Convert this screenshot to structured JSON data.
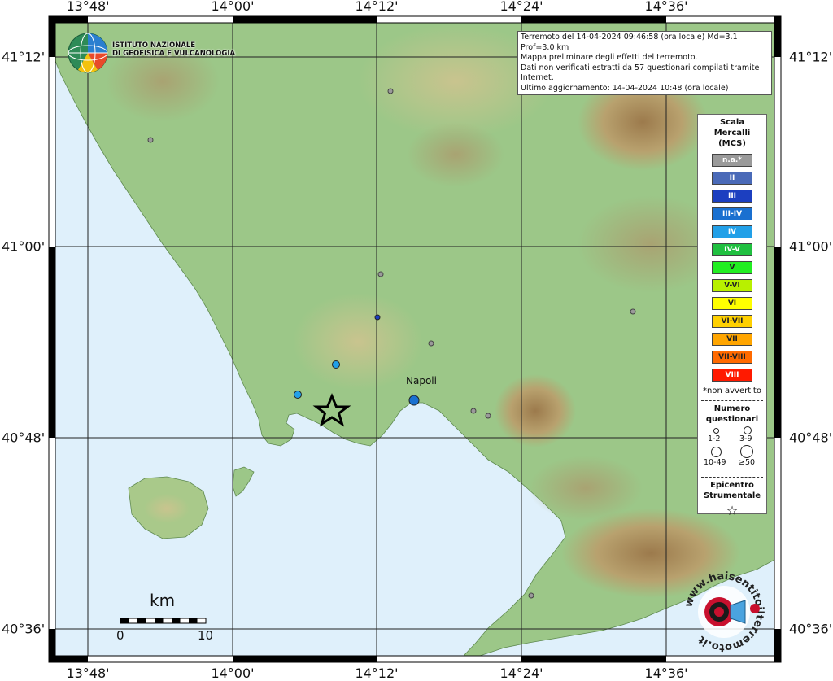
{
  "map": {
    "lon_labels": [
      "13°48'",
      "14°00'",
      "14°12'",
      "14°24'",
      "14°36'"
    ],
    "lat_labels": [
      "41°12'",
      "41°00'",
      "40°48'",
      "40°36'"
    ],
    "city_label": "Napoli"
  },
  "header": {
    "org_line1": "ISTITUTO NAZIONALE",
    "org_line2": "DI GEOFISICA E VULCANOLOGIA"
  },
  "info": {
    "line1": "Terremoto del 14-04-2024 09:46:58 (ora locale) Md=3.1 Prof=3.0 km",
    "line2": "Mappa preliminare degli effetti del terremoto.",
    "line3": "Dati non verificati estratti da 57 questionari compilati tramite Internet.",
    "line4": "Ultimo aggiornamento: 14-04-2024 10:48 (ora locale)"
  },
  "legend": {
    "title1": "Scala",
    "title2": "Mercalli",
    "title3": "(MCS)",
    "scale": [
      {
        "label": "n.a.*",
        "color": "#9a9a9a"
      },
      {
        "label": "II",
        "color": "#4a6ab8"
      },
      {
        "label": "III",
        "color": "#1c3fc0"
      },
      {
        "label": "III-IV",
        "color": "#1a70d0"
      },
      {
        "label": "IV",
        "color": "#22a0e8"
      },
      {
        "label": "IV-V",
        "color": "#20c040"
      },
      {
        "label": "V",
        "color": "#22ee22"
      },
      {
        "label": "V-VI",
        "color": "#b8f000"
      },
      {
        "label": "VI",
        "color": "#ffff00"
      },
      {
        "label": "VI-VII",
        "color": "#ffd000"
      },
      {
        "label": "VII",
        "color": "#ffa500"
      },
      {
        "label": "VII-VIII",
        "color": "#ff6a00"
      },
      {
        "label": "VIII",
        "color": "#ff1a00"
      }
    ],
    "note": "*non avvertito",
    "count_title1": "Numero",
    "count_title2": "questionari",
    "sizes": [
      "1-2",
      "3-9",
      "10-49",
      "≥50"
    ],
    "epi_title1": "Epicentro",
    "epi_title2": "Strumentale",
    "epi_symbol": "☆"
  },
  "scalebar": {
    "unit": "km",
    "start": "0",
    "end": "10"
  },
  "watermark": {
    "text": "www.haisentitoilterremoto.it"
  }
}
